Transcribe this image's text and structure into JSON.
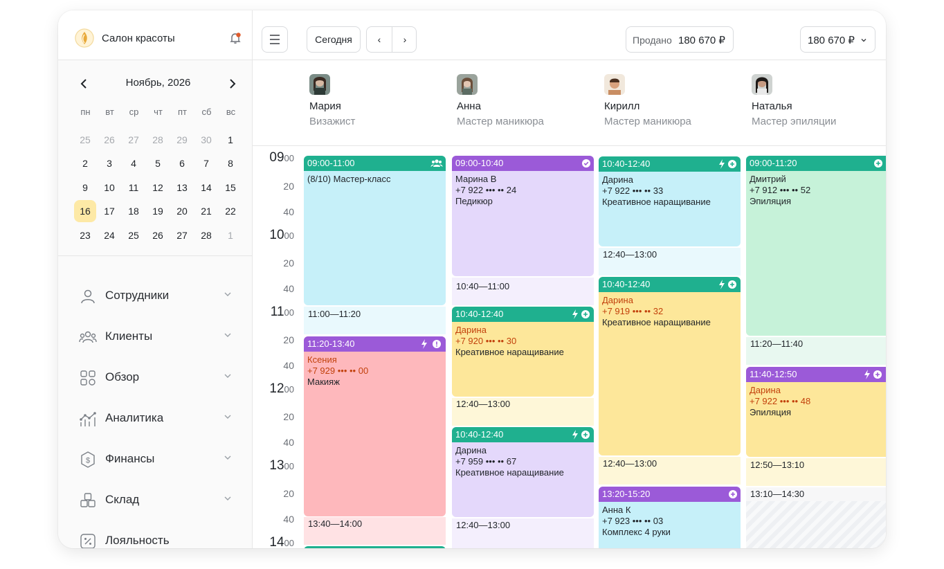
{
  "brand": {
    "name": "Салон красоты"
  },
  "calendar": {
    "month_title": "Ноябрь, 2026",
    "weekdays": [
      "пн",
      "вт",
      "ср",
      "чт",
      "пт",
      "сб",
      "вс"
    ],
    "days": [
      {
        "d": "25",
        "muted": true
      },
      {
        "d": "26",
        "muted": true
      },
      {
        "d": "27",
        "muted": true
      },
      {
        "d": "28",
        "muted": true
      },
      {
        "d": "29",
        "muted": true
      },
      {
        "d": "30",
        "muted": true
      },
      {
        "d": "1",
        "muted": false
      },
      {
        "d": "2",
        "muted": false
      },
      {
        "d": "3",
        "muted": false
      },
      {
        "d": "4",
        "muted": false
      },
      {
        "d": "5",
        "muted": false
      },
      {
        "d": "6",
        "muted": false
      },
      {
        "d": "7",
        "muted": false
      },
      {
        "d": "8",
        "muted": false
      },
      {
        "d": "9",
        "muted": false
      },
      {
        "d": "10",
        "muted": false
      },
      {
        "d": "11",
        "muted": false
      },
      {
        "d": "12",
        "muted": false
      },
      {
        "d": "13",
        "muted": false
      },
      {
        "d": "14",
        "muted": false
      },
      {
        "d": "15",
        "muted": false
      },
      {
        "d": "16",
        "muted": false,
        "today": true
      },
      {
        "d": "17",
        "muted": false
      },
      {
        "d": "18",
        "muted": false
      },
      {
        "d": "19",
        "muted": false
      },
      {
        "d": "20",
        "muted": false
      },
      {
        "d": "21",
        "muted": false
      },
      {
        "d": "22",
        "muted": false
      },
      {
        "d": "23",
        "muted": false
      },
      {
        "d": "24",
        "muted": false
      },
      {
        "d": "25",
        "muted": false
      },
      {
        "d": "26",
        "muted": false
      },
      {
        "d": "27",
        "muted": false
      },
      {
        "d": "28",
        "muted": false
      },
      {
        "d": "1",
        "muted": true
      }
    ]
  },
  "nav": [
    {
      "label": "Сотрудники",
      "icon": "user-icon"
    },
    {
      "label": "Клиенты",
      "icon": "users-icon"
    },
    {
      "label": "Обзор",
      "icon": "grid-icon"
    },
    {
      "label": "Аналитика",
      "icon": "analytics-icon"
    },
    {
      "label": "Финансы",
      "icon": "finance-icon"
    },
    {
      "label": "Склад",
      "icon": "warehouse-icon"
    },
    {
      "label": "Лояльность",
      "icon": "loyalty-icon"
    }
  ],
  "toolbar": {
    "today_label": "Сегодня",
    "prev_label": "‹",
    "next_label": "›",
    "sold_label": "Продано",
    "sold_value": "180 670 ₽",
    "total_value": "180 670 ₽"
  },
  "staff": [
    {
      "name": "Мария",
      "role": "Визажист"
    },
    {
      "name": "Анна",
      "role": "Мастер маникюра"
    },
    {
      "name": "Кирилл",
      "role": "Мастер маникюра"
    },
    {
      "name": "Наталья",
      "role": "Мастер эпиляции"
    }
  ],
  "times": {
    "h09": "09",
    "h10": "10",
    "h11": "11",
    "h12": "12",
    "h13": "13",
    "h14": "14",
    "m00": "00",
    "m20": "20",
    "m40": "40"
  },
  "appointments": {
    "c1a": {
      "time": "09:00-11:00",
      "l1": "(8/10) Мастер-класс"
    },
    "c1gap1": "11:00—11:20",
    "c1b": {
      "time": "11:20-13:40",
      "l1": "Ксения",
      "l2": "+7 929 ••• •• 00",
      "l3": "Макияж"
    },
    "c1gap2": "13:40—14:00",
    "c2a": {
      "time": "09:00-10:40",
      "l1": "Марина В",
      "l2": "+7 922 ••• •• 24",
      "l3": "Педикюр"
    },
    "c2gap1": "10:40—11:00",
    "c2b": {
      "time": "10:40-12:40",
      "l1": "Дарина",
      "l2": "+7 920 ••• •• 30",
      "l3": "Креативное наращивание"
    },
    "c2gap2": "12:40—13:00",
    "c2c": {
      "time": "10:40-12:40",
      "l1": "Дарина",
      "l2": "+7 959 ••• •• 67",
      "l3": "Креативное наращивание"
    },
    "c2gap3": "12:40—13:00",
    "c3a": {
      "time": "10:40-12:40",
      "l1": "Дарина",
      "l2": "+7 922 ••• •• 33",
      "l3": "Креативное наращивание"
    },
    "c3gap1": "12:40—13:00",
    "c3b": {
      "time": "10:40-12:40",
      "l1": "Дарина",
      "l2": "+7 919 ••• •• 32",
      "l3": "Креативное наращивание"
    },
    "c3gap2": "12:40—13:00",
    "c3c": {
      "time": "13:20-15:20",
      "l1": "Анна К",
      "l2": "+7 923 ••• •• 03",
      "l3": "Комплекс 4 руки"
    },
    "c4a": {
      "time": "09:00-11:20",
      "l1": "Дмитрий",
      "l2": "+7 912 ••• •• 52",
      "l3": "Эпиляция"
    },
    "c4gap1": "11:20—11:40",
    "c4b": {
      "time": "11:40-12:50",
      "l1": "Дарина",
      "l2": "+7 922 ••• •• 48",
      "l3": "Эпиляция"
    },
    "c4gap2": "12:50—13:10",
    "c4gap3": "13:10—14:30"
  },
  "colors": {
    "header_green": "#1fb08f",
    "header_purple": "#9b5ad8",
    "today_highlight": "#fde9a6"
  }
}
